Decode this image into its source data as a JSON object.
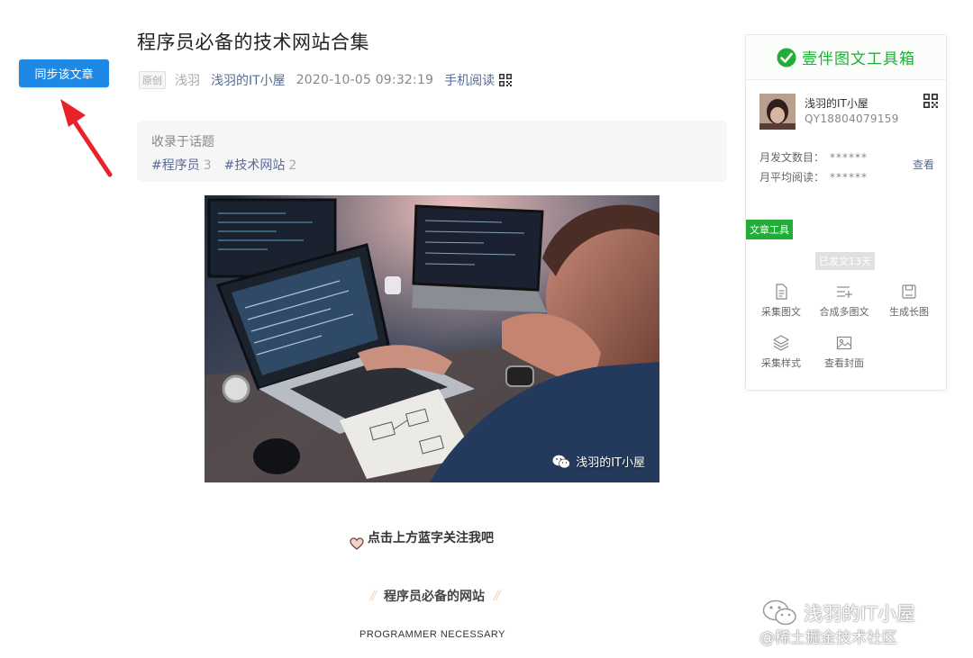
{
  "sync_button": {
    "label": "同步该文章"
  },
  "article": {
    "title": "程序员必备的技术网站合集",
    "original_tag": "原创",
    "author": "浅羽",
    "account": "浅羽的IT小屋",
    "datetime": "2020-10-05 09:32:19",
    "mobile_read": "手机阅读"
  },
  "topics": {
    "heading": "收录于话题",
    "items": [
      {
        "tag": "#程序员",
        "count": "3"
      },
      {
        "tag": "#技术网站",
        "count": "2"
      }
    ]
  },
  "hero": {
    "watermark": "浅羽的IT小屋"
  },
  "content": {
    "follow_prompt": "点击上方蓝字关注我吧",
    "section_title": "程序员必备的网站",
    "section_title_en": "PROGRAMMER NECESSARY"
  },
  "site_watermark": {
    "line1": "浅羽的IT小屋",
    "line2": "@稀土掘金技术社区"
  },
  "panel": {
    "brand": "壹伴图文工具箱",
    "account_name": "浅羽的IT小屋",
    "account_id": "QY18804079159",
    "stats": [
      {
        "label": "月发文数目：",
        "value": "******"
      },
      {
        "label": "月平均阅读：",
        "value": "******"
      }
    ],
    "view_link": "查看",
    "tools_tag": "文章工具",
    "days_badge": "已发文13天",
    "tools": [
      {
        "label": "采集图文",
        "icon": "document-icon"
      },
      {
        "label": "合成多图文",
        "icon": "list-add-icon"
      },
      {
        "label": "生成长图",
        "icon": "save-icon"
      },
      {
        "label": "采集样式",
        "icon": "layers-icon"
      },
      {
        "label": "查看封面",
        "icon": "image-icon"
      }
    ]
  },
  "colors": {
    "accent_blue": "#1e88e5",
    "link": "#576b95",
    "brand_green": "#22ac38",
    "arrow_red": "#e8212a"
  }
}
